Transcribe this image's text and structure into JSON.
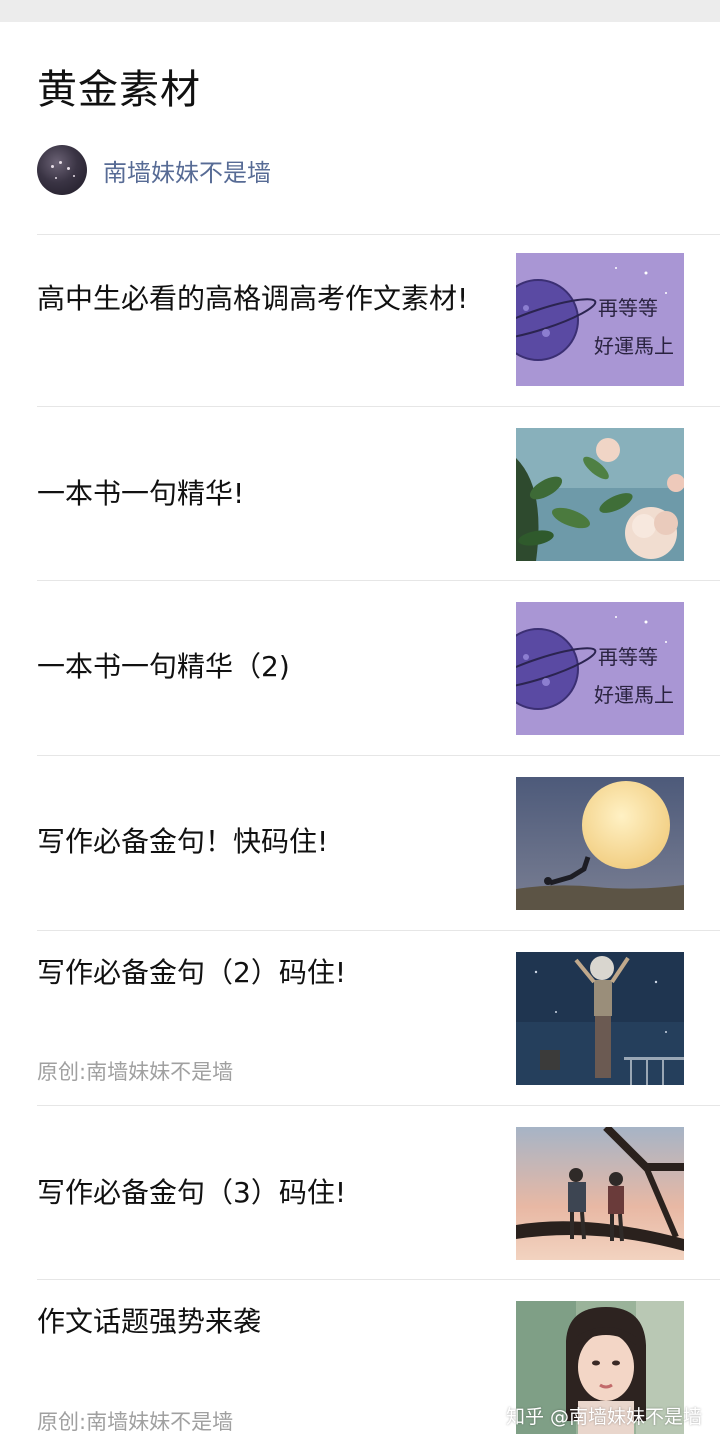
{
  "header": {
    "title": "黄金素材",
    "author_name": "南墙妹妹不是墙",
    "avatar_icon": "avatar-night-sky"
  },
  "articles": [
    {
      "title": "高中生必看的高格调高考作文素材!",
      "meta": "",
      "thumb": "purple-planet-image"
    },
    {
      "title": "一本书一句精华!",
      "meta": "",
      "thumb": "flowers-image"
    },
    {
      "title": "一本书一句精华（2)",
      "meta": "",
      "thumb": "purple-planet-image"
    },
    {
      "title": "写作必备金句！快码住!",
      "meta": "",
      "thumb": "moon-image"
    },
    {
      "title": "写作必备金句（2）码住!",
      "meta": "原创:南墙妹妹不是墙",
      "thumb": "astronaut-image"
    },
    {
      "title": "写作必备金句（3）码住!",
      "meta": "",
      "thumb": "couple-tree-image"
    },
    {
      "title": "作文话题强势来袭",
      "meta": "原创:南墙妹妹不是墙",
      "thumb": "portrait-image"
    }
  ],
  "watermark": "知乎 @南墙妹妹不是墙",
  "colors": {
    "author_link": "#576b95",
    "meta_gray": "#a0a0a0",
    "divider": "#e6e6e6"
  }
}
